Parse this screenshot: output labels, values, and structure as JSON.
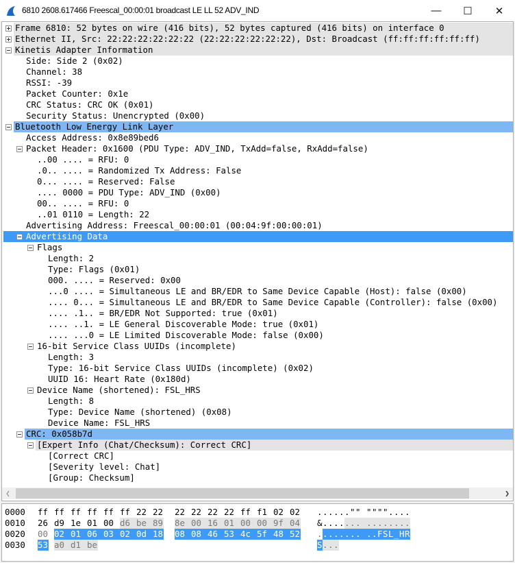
{
  "window": {
    "title": "6810 2608.617466 Freescal_00:00:01 broadcast LE LL 52 ADV_IND",
    "minimize": "—",
    "maximize": "☐",
    "close": "✕"
  },
  "colors": {
    "selected": "#3d9af6",
    "related": "#7fb7f5",
    "group": "#e4e4e4"
  },
  "tree": [
    {
      "level": 0,
      "expander": "plus",
      "style": "gray",
      "text": "Frame 6810: 52 bytes on wire (416 bits), 52 bytes captured (416 bits) on interface 0"
    },
    {
      "level": 0,
      "expander": "plus",
      "style": "gray",
      "text": "Ethernet II, Src: 22:22:22:22:22:22 (22:22:22:22:22:22), Dst: Broadcast (ff:ff:ff:ff:ff:ff)"
    },
    {
      "level": 0,
      "expander": "minus",
      "style": "gray",
      "text": "Kinetis Adapter Information"
    },
    {
      "level": 1,
      "text": "Side: Side 2 (0x02)"
    },
    {
      "level": 1,
      "text": "Channel: 38"
    },
    {
      "level": 1,
      "text": "RSSI: -39"
    },
    {
      "level": 1,
      "text": "Packet Counter: 0x1e"
    },
    {
      "level": 1,
      "text": "CRC Status: CRC OK (0x01)"
    },
    {
      "level": 1,
      "text": "Security Status: Unencrypted (0x00)"
    },
    {
      "level": 0,
      "expander": "minus",
      "style": "light",
      "text": "Bluetooth Low Energy Link Layer"
    },
    {
      "level": 1,
      "text": "Access Address: 0x8e89bed6"
    },
    {
      "level": 1,
      "expander": "minus",
      "text": "Packet Header: 0x1600 (PDU Type: ADV_IND, TxAdd=false, RxAdd=false)"
    },
    {
      "level": 2,
      "text": "..00 .... = RFU: 0"
    },
    {
      "level": 2,
      "text": ".0.. .... = Randomized Tx Address: False"
    },
    {
      "level": 2,
      "text": "0... .... = Reserved: False"
    },
    {
      "level": 2,
      "text": ".... 0000 = PDU Type: ADV_IND (0x00)"
    },
    {
      "level": 2,
      "text": "00.. .... = RFU: 0"
    },
    {
      "level": 2,
      "text": "..01 0110 = Length: 22"
    },
    {
      "level": 1,
      "text": "Advertising Address: Freescal_00:00:01 (00:04:9f:00:00:01)"
    },
    {
      "level": 1,
      "expander": "minus",
      "style": "sel",
      "text": "Advertising Data"
    },
    {
      "level": 2,
      "expander": "minus",
      "text": "Flags"
    },
    {
      "level": 3,
      "text": "Length: 2"
    },
    {
      "level": 3,
      "text": "Type: Flags (0x01)"
    },
    {
      "level": 3,
      "text": "000. .... = Reserved: 0x00"
    },
    {
      "level": 3,
      "text": "...0 .... = Simultaneous LE and BR/EDR to Same Device Capable (Host): false (0x00)"
    },
    {
      "level": 3,
      "text": ".... 0... = Simultaneous LE and BR/EDR to Same Device Capable (Controller): false (0x00)"
    },
    {
      "level": 3,
      "text": ".... .1.. = BR/EDR Not Supported: true (0x01)"
    },
    {
      "level": 3,
      "text": ".... ..1. = LE General Discoverable Mode: true (0x01)"
    },
    {
      "level": 3,
      "text": ".... ...0 = LE Limited Discoverable Mode: false (0x00)"
    },
    {
      "level": 2,
      "expander": "minus",
      "text": "16-bit Service Class UUIDs (incomplete)"
    },
    {
      "level": 3,
      "text": "Length: 3"
    },
    {
      "level": 3,
      "text": "Type: 16-bit Service Class UUIDs (incomplete) (0x02)"
    },
    {
      "level": 3,
      "text": "UUID 16: Heart Rate (0x180d)"
    },
    {
      "level": 2,
      "expander": "minus",
      "text": "Device Name (shortened): FSL_HRS"
    },
    {
      "level": 3,
      "text": "Length: 8"
    },
    {
      "level": 3,
      "text": "Type: Device Name (shortened) (0x08)"
    },
    {
      "level": 3,
      "text": "Device Name: FSL_HRS"
    },
    {
      "level": 1,
      "expander": "minus",
      "style": "light",
      "text": "CRC: 0x058b7d"
    },
    {
      "level": 2,
      "expander": "minus",
      "style": "gray",
      "text": "[Expert Info (Chat/Checksum): Correct CRC]"
    },
    {
      "level": 3,
      "text": "[Correct CRC]"
    },
    {
      "level": 3,
      "text": "[Severity level: Chat]"
    },
    {
      "level": 3,
      "text": "[Group: Checksum]"
    }
  ],
  "hex": {
    "layer_range": [
      21,
      51
    ],
    "dim_range": [
      32,
      32
    ],
    "selected_range": [
      33,
      48
    ],
    "rows": [
      {
        "offset": "0000",
        "bytes": [
          "ff",
          "ff",
          "ff",
          "ff",
          "ff",
          "ff",
          "22",
          "22",
          "22",
          "22",
          "22",
          "22",
          "ff",
          "f1",
          "02",
          "02"
        ],
        "ascii": "......\"\"\"\"\"\"...."
      },
      {
        "offset": "0010",
        "bytes": [
          "26",
          "d9",
          "1e",
          "01",
          "00",
          "d6",
          "be",
          "89",
          "8e",
          "00",
          "16",
          "01",
          "00",
          "00",
          "9f",
          "04"
        ],
        "ascii": "&..............."
      },
      {
        "offset": "0020",
        "bytes": [
          "00",
          "02",
          "01",
          "06",
          "03",
          "02",
          "0d",
          "18",
          "08",
          "08",
          "46",
          "53",
          "4c",
          "5f",
          "48",
          "52"
        ],
        "ascii": "..........FSL_HR"
      },
      {
        "offset": "0030",
        "bytes": [
          "53",
          "a0",
          "d1",
          "be"
        ],
        "ascii": "S..."
      }
    ]
  }
}
